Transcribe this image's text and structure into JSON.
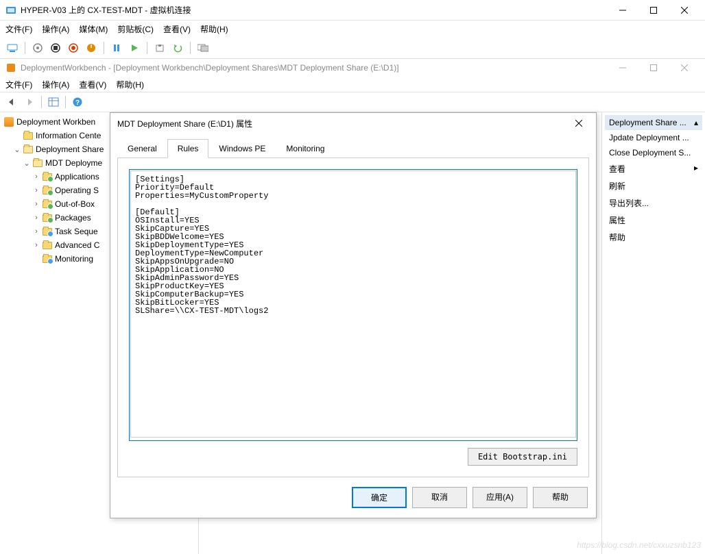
{
  "hyperv": {
    "title": "HYPER-V03 上的 CX-TEST-MDT - 虚拟机连接",
    "menu": {
      "file": "文件(F)",
      "action": "操作(A)",
      "media": "媒体(M)",
      "clipboard": "剪贴板(C)",
      "view": "查看(V)",
      "help": "帮助(H)"
    }
  },
  "mmc": {
    "title": "DeploymentWorkbench - [Deployment Workbench\\Deployment Shares\\MDT Deployment Share (E:\\D1)]",
    "menu": {
      "file": "文件(F)",
      "action": "操作(A)",
      "view": "查看(V)",
      "help": "帮助(H)"
    }
  },
  "tree": {
    "root": "Deployment Workben",
    "info": "Information Cente",
    "shares": "Deployment Share",
    "mdt": "MDT Deployme",
    "apps": "Applications",
    "os": "Operating S",
    "oob": "Out-of-Box",
    "pkg": "Packages",
    "task": "Task Seque",
    "adv": "Advanced C",
    "mon": "Monitoring"
  },
  "actions": {
    "header": "Deployment Share ...",
    "update": "Jpdate Deployment ...",
    "close": "Close Deployment S...",
    "view": "查看",
    "refresh": "刷新",
    "export": "导出列表...",
    "props": "属性",
    "help": "帮助"
  },
  "dialog": {
    "title": "MDT Deployment Share (E:\\D1) 属性",
    "tabs": {
      "general": "General",
      "rules": "Rules",
      "winpe": "Windows PE",
      "monitoring": "Monitoring"
    },
    "rules_text": "[Settings]\nPriority=Default\nProperties=MyCustomProperty\n\n[Default]\nOSInstall=YES\nSkipCapture=YES\nSkipBDDWelcome=YES\nSkipDeploymentType=YES\nDeploymentType=NewComputer\nSkipAppsOnUpgrade=NO\nSkipApplication=NO\nSkipAdminPassword=YES\nSkipProductKey=YES\nSkipComputerBackup=YES\nSkipBitLocker=YES\nSLShare=\\\\CX-TEST-MDT\\logs2",
    "edit_bootstrap": "Edit Bootstrap.ini",
    "ok": "确定",
    "cancel": "取消",
    "apply": "应用(A)",
    "help": "帮助"
  },
  "watermark": "https://blog.csdn.net/cxxuzsnb123"
}
